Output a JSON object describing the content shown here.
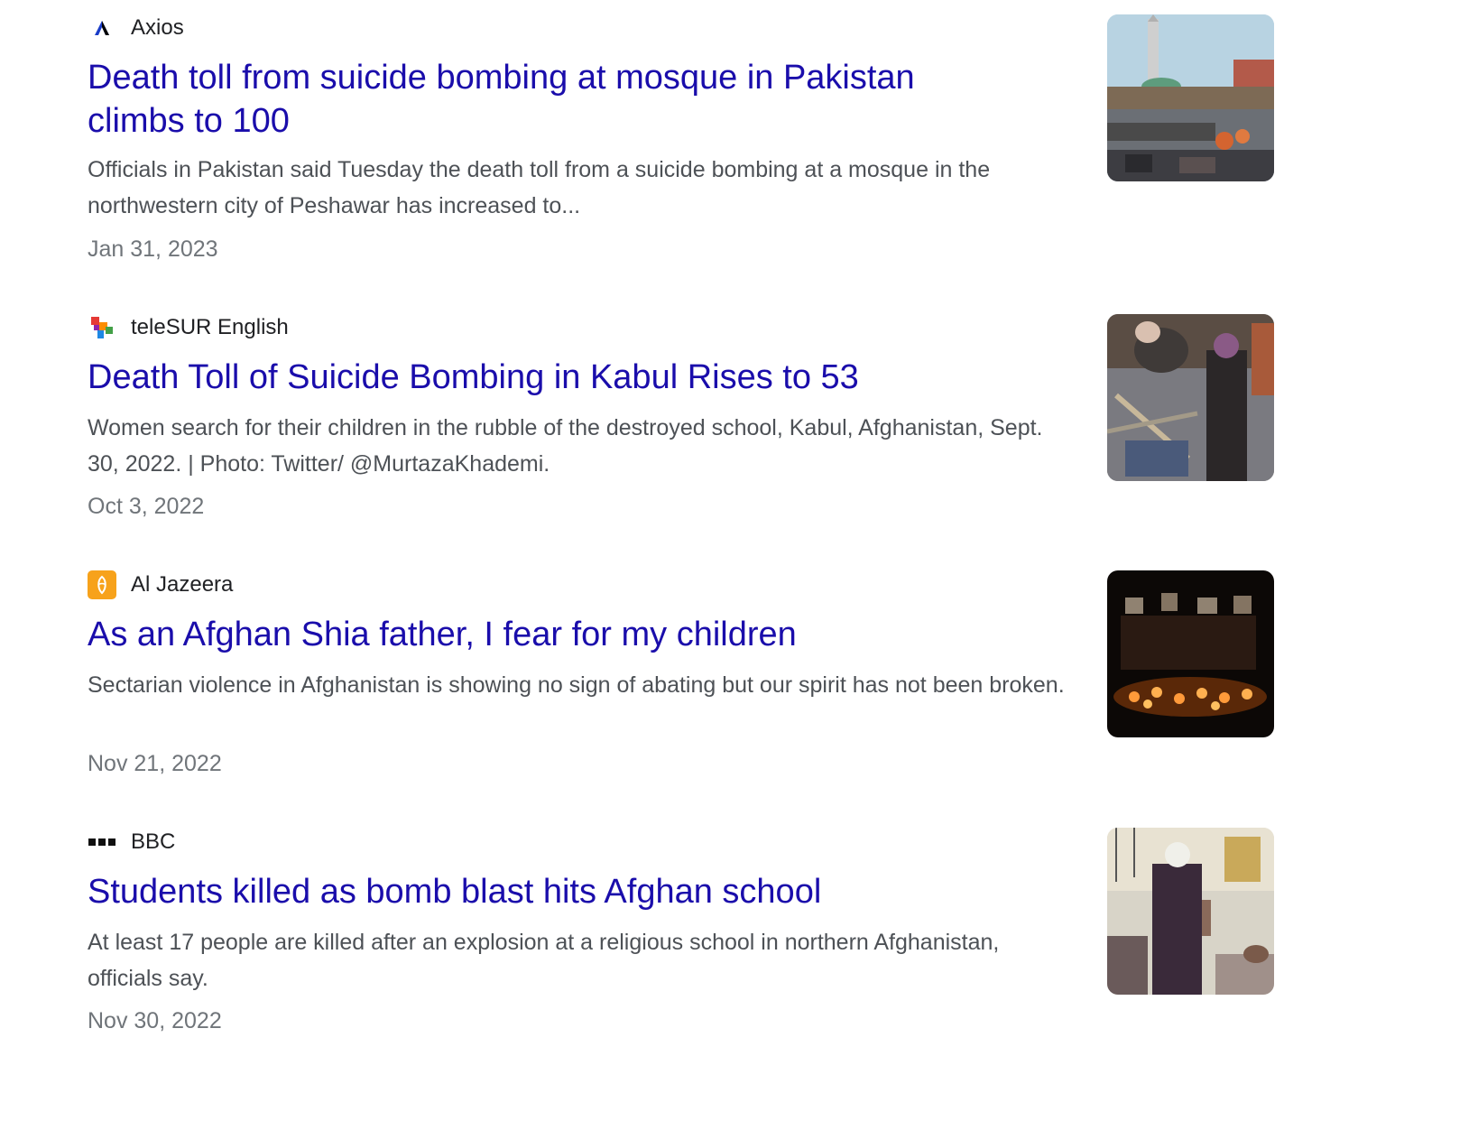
{
  "results": [
    {
      "source": "Axios",
      "source_icon": "axios-logo-icon",
      "title": "Death toll from suicide bombing at mosque in Pakistan climbs to 100",
      "snippet": "Officials in Pakistan said Tuesday the death toll from a suicide bombing at a mosque in the northwestern city of Peshawar has increased to...",
      "date": "Jan 31, 2023",
      "thumbnail": "mosque-street-photo"
    },
    {
      "source": "teleSUR English",
      "source_icon": "telesur-logo-icon",
      "title": "Death Toll of Suicide Bombing in Kabul Rises to 53",
      "snippet": "Women search for their children in the rubble of the destroyed school, Kabul, Afghanistan, Sept. 30, 2022. | Photo: Twitter/ @MurtazaKhademi.",
      "date": "Oct 3, 2022",
      "thumbnail": "school-rubble-photo"
    },
    {
      "source": "Al Jazeera",
      "source_icon": "aljazeera-logo-icon",
      "title": "As an Afghan Shia father, I fear for my children",
      "snippet": "Sectarian violence in Afghanistan is showing no sign of abating but our spirit has not been broken.",
      "date": "Nov 21, 2022",
      "thumbnail": "candle-vigil-photo"
    },
    {
      "source": "BBC",
      "source_icon": "bbc-logo-icon",
      "title": "Students killed as bomb blast hits Afghan school",
      "snippet": "At least 17 people are killed after an explosion at a religious school in northern Afghanistan, officials say.",
      "date": "Nov 30, 2022",
      "thumbnail": "hospital-ward-photo"
    }
  ],
  "colors": {
    "title_link": "#1a0dab",
    "snippet": "#4d5156",
    "date": "#70757a",
    "source": "#202124"
  }
}
